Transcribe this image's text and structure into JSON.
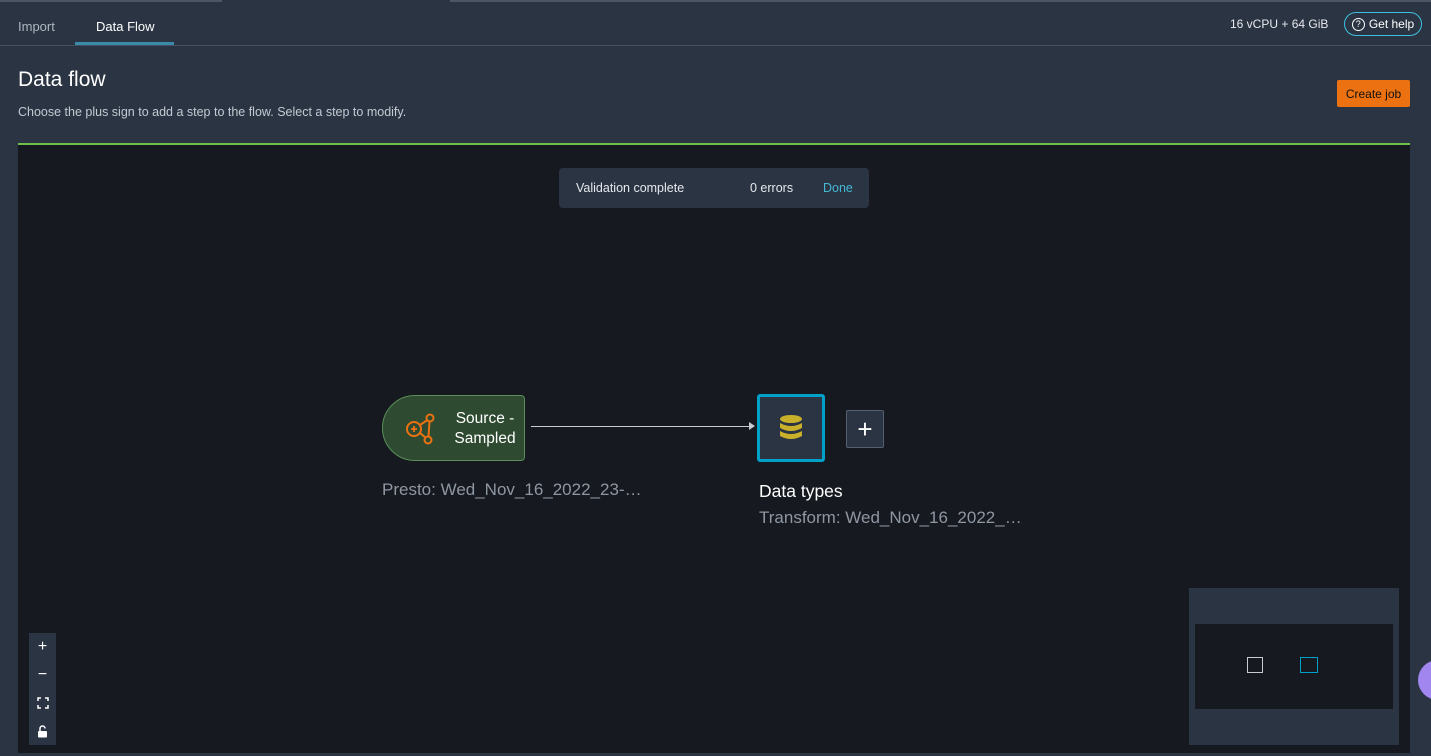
{
  "tabs": [
    {
      "label": "Import",
      "active": false
    },
    {
      "label": "Data Flow",
      "active": true
    }
  ],
  "header": {
    "resource": "16 vCPU + 64 GiB",
    "help_label": "Get help",
    "help_icon": "help-circle-icon"
  },
  "page": {
    "title": "Data flow",
    "subtitle": "Choose the plus sign to add a step to the flow. Select a step to modify.",
    "create_job_label": "Create job"
  },
  "validation": {
    "message": "Validation complete",
    "errors": "0 errors",
    "done_label": "Done"
  },
  "flow": {
    "source": {
      "label": "Source - Sampled",
      "caption": "Presto: Wed_Nov_16_2022_23-…",
      "icon": "source-graph-icon"
    },
    "transform": {
      "title": "Data types",
      "caption": "Transform: Wed_Nov_16_2022_…",
      "icon": "database-icon"
    },
    "add_step_icon": "plus-icon"
  },
  "zoom_controls": [
    {
      "name": "zoom-in-icon",
      "glyph": "+"
    },
    {
      "name": "zoom-out-icon",
      "glyph": "−"
    },
    {
      "name": "fit-view-icon",
      "glyph": "⛶"
    },
    {
      "name": "lock-icon",
      "glyph": "🔓"
    }
  ],
  "colors": {
    "accent": "#00a1c9",
    "primary_button": "#ec7211",
    "status_ok": "#6cc04a",
    "source_icon": "#ec7211",
    "database_icon": "#c8b02a"
  }
}
